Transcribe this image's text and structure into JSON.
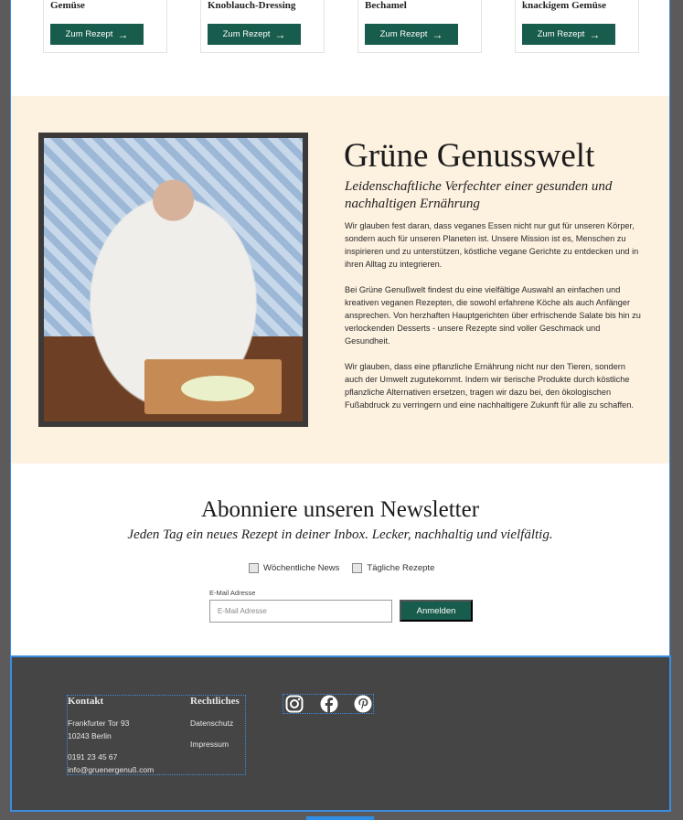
{
  "recipe_cards": [
    {
      "title": "Gemüse",
      "button": "Zum Rezept"
    },
    {
      "title": "Knoblauch-Dressing",
      "button": "Zum Rezept"
    },
    {
      "title": "Bechamel",
      "button": "Zum Rezept"
    },
    {
      "title": "knackigem Gemüse",
      "button": "Zum Rezept"
    }
  ],
  "about": {
    "title": "Grüne Genusswelt",
    "subtitle": "Leidenschaftliche Verfechter einer gesunden und nachhaltigen Ernährung",
    "paragraphs": [
      "Wir glauben fest daran, dass veganes Essen nicht nur gut für unseren Körper, sondern auch für unseren Planeten ist. Unsere Mission ist es, Menschen zu inspirieren und zu unterstützen, köstliche vegane Gerichte zu entdecken und in ihren Alltag zu integrieren.",
      "Bei Grüne Genußwelt findest du eine vielfältige Auswahl an einfachen und kreativen veganen Rezepten, die sowohl erfahrene Köche als auch Anfänger ansprechen. Von herzhaften Hauptgerichten über erfrischende Salate bis hin zu verlockenden Desserts - unsere Rezepte sind voller Geschmack und Gesundheit.",
      "Wir glauben, dass eine pflanzliche Ernährung nicht nur den Tieren, sondern auch der Umwelt zugutekommt. Indem wir tierische Produkte durch köstliche pflanzliche Alternativen ersetzen, tragen wir dazu bei, den ökologischen Fußabdruck zu verringern und eine nachhaltigere Zukunft für alle zu schaffen."
    ]
  },
  "newsletter": {
    "title": "Abonniere unseren Newsletter",
    "subtitle": "Jeden Tag ein neues Rezept in deiner Inbox. Lecker, nachhaltig und vielfältig.",
    "options": [
      "Wöchentliche News",
      "Tägliche Rezepte"
    ],
    "email_label": "E-Mail Adresse",
    "email_placeholder": "E-Mail Adresse",
    "button": "Anmelden"
  },
  "footer": {
    "contact_heading": "Kontakt",
    "street": "Frankfurter Tor 93",
    "city": "10243 Berlin",
    "phone": "0191 23 45 67",
    "email": "info@gruenergenuß.com",
    "legal_heading": "Rechtliches",
    "legal_links": [
      "Datenschutz",
      "Impressum"
    ],
    "socials": [
      "instagram-icon",
      "facebook-icon",
      "pinterest-icon"
    ]
  },
  "colors": {
    "accent": "#175c4c",
    "about_bg": "#fdf1e0",
    "footer_bg": "#464545",
    "selection": "#3a8ee0"
  }
}
